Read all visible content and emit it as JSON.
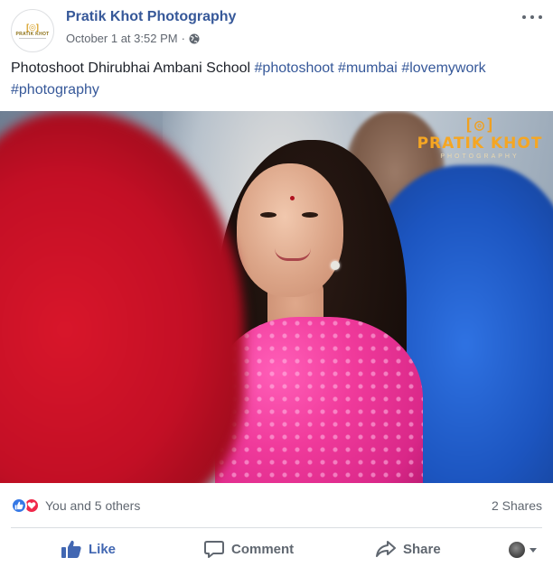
{
  "post": {
    "page_name": "Pratik Khot Photography",
    "timestamp": "October 1 at 3:52 PM",
    "separator": "·",
    "privacy_icon": "globe-icon",
    "more_icon": "more-options-icon",
    "avatar": {
      "logo_mark": "[◎]",
      "logo_text": "PRATIK KHOT"
    },
    "caption": {
      "text": "Photoshoot Dhirubhai Ambani School ",
      "hashtags": [
        "#photoshoot",
        "#mumbai",
        "#lovemywork",
        "#photography"
      ]
    },
    "photo": {
      "watermark": {
        "mark": "[◎]",
        "name": "PRATIK KHOT",
        "sub": "PHOTOGRAPHY"
      }
    }
  },
  "reactions": {
    "icons": [
      "like-reaction-icon",
      "love-reaction-icon"
    ],
    "summary": "You and 5 others",
    "shares": "2 Shares"
  },
  "actions": {
    "like": "Like",
    "comment": "Comment",
    "share": "Share"
  },
  "colors": {
    "link_blue": "#365899",
    "like_blue": "#4267b2",
    "love_red": "#f0284a",
    "watermark_orange": "#f5a623"
  }
}
